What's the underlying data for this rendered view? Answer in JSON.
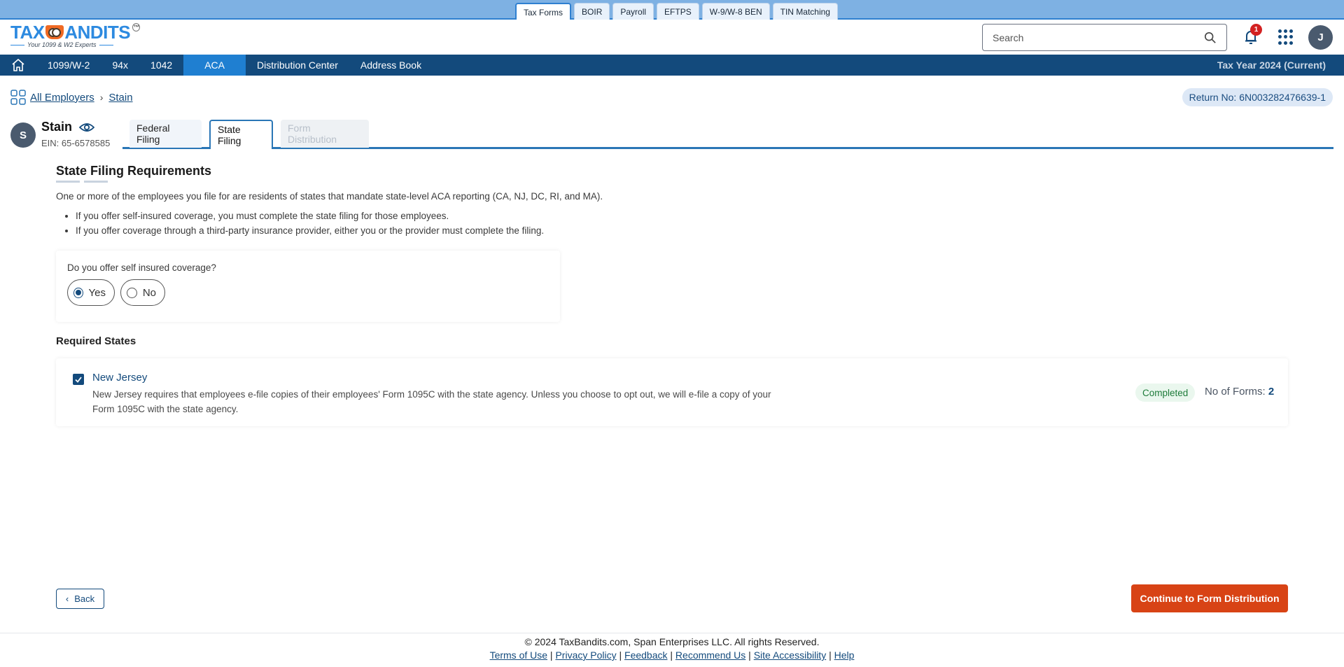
{
  "product_tabs": [
    "Tax Forms",
    "BOIR",
    "Payroll",
    "EFTPS",
    "W-9/W-8 BEN",
    "TIN Matching"
  ],
  "logo": {
    "text_left": "TAX",
    "text_right": "ANDITS",
    "tagline": "Your 1099 & W2 Experts",
    "tm": "TM"
  },
  "header": {
    "search_placeholder": "Search",
    "notification_count": "1",
    "user_initial": "J"
  },
  "nav": {
    "items": [
      "1099/W-2",
      "94x",
      "1042",
      "ACA",
      "Distribution Center",
      "Address Book"
    ],
    "active": "ACA",
    "tax_year": "Tax Year 2024 (Current)"
  },
  "breadcrumb": {
    "root": "All Employers",
    "current": "Stain"
  },
  "return_no": "Return No: 6N003282476639-1",
  "employer": {
    "initial": "S",
    "name": "Stain",
    "ein": "EIN: 65-6578585"
  },
  "filing_tabs": [
    {
      "label": "Federal Filing",
      "state": "normal"
    },
    {
      "label": "State Filing",
      "state": "active"
    },
    {
      "label": "Form Distribution",
      "state": "disabled"
    }
  ],
  "section": {
    "title": "State Filing Requirements",
    "intro": "One or more of the employees you file for are residents of states that mandate state-level ACA reporting (CA, NJ, DC, RI, and MA).",
    "bullets": [
      "If you offer self-insured coverage, you must complete the state filing for those employees.",
      "If you offer coverage through a third-party insurance provider, either you or the provider must complete the filing."
    ]
  },
  "question": {
    "label": "Do you offer self insured coverage?",
    "options": [
      "Yes",
      "No"
    ],
    "selected": "Yes"
  },
  "required_states": {
    "title": "Required States",
    "items": [
      {
        "name": "New Jersey",
        "checked": true,
        "description": "New Jersey requires that employees e-file copies of their employees' Form 1095C with the state agency. Unless you choose to opt out, we will e-file a copy of your Form 1095C with the state agency.",
        "status": "Completed",
        "forms_label": "No of Forms:",
        "forms_count": "2"
      }
    ]
  },
  "buttons": {
    "back": "Back",
    "continue": "Continue to Form Distribution"
  },
  "footer": {
    "copyright": "© 2024 TaxBandits.com, Span Enterprises LLC. All rights Reserved.",
    "links": [
      "Terms of Use",
      "Privacy Policy",
      "Feedback",
      "Recommend Us",
      "Site Accessibility",
      "Help"
    ]
  },
  "colors": {
    "brand_navy": "#134a7c",
    "accent_blue": "#1f7fd1",
    "cta_orange": "#d84315",
    "success_green": "#1e7b3a"
  }
}
